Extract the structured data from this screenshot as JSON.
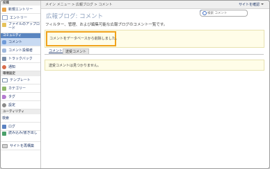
{
  "header": {
    "breadcrumb": "メイン メニュー > 広報ブログ > コメント",
    "site_link": "サイトを確認"
  },
  "search": {
    "placeholder": "検索 コメント"
  },
  "main": {
    "title": "広報ブログ: コメント",
    "description": "フィルター、管理、および編集可能な広報ブログのコメント一覧です。",
    "message": "コメントをデータベースから削除しました。",
    "tabs": [
      {
        "label": "コメント"
      },
      {
        "label": "送受コメント"
      }
    ],
    "empty_message": "送受コメントは見つかりません。"
  },
  "sidebar": {
    "sections": [
      {
        "title": "投稿",
        "items": [
          {
            "label": "新規エントリー",
            "icon": "pen-icon"
          },
          {
            "label": "エントリー",
            "icon": "document-icon"
          },
          {
            "label": "ファイルのアップロード",
            "icon": "folder-icon"
          }
        ]
      },
      {
        "title": "コミュニティ",
        "items": [
          {
            "label": "コメント",
            "icon": "comment-icon",
            "active": true
          },
          {
            "label": "コメント投稿者",
            "icon": "commenter-icon"
          },
          {
            "label": "トラックバック",
            "icon": "trackback-icon"
          },
          {
            "label": "通知",
            "icon": "notification-icon"
          }
        ]
      },
      {
        "title": "環境設定",
        "items": [
          {
            "label": "テンプレート",
            "icon": "template-icon"
          },
          {
            "label": "カテゴリー",
            "icon": "category-icon"
          },
          {
            "label": "タグ",
            "icon": "tag-icon"
          },
          {
            "label": "設定",
            "icon": "gear-icon"
          }
        ]
      },
      {
        "title": "ユーティリティ",
        "items": [
          {
            "label": "検索",
            "icon": "search-icon"
          },
          {
            "label": "ログ",
            "icon": "log-icon"
          },
          {
            "label": "読み込み/書き出し",
            "icon": "import-export-icon"
          },
          {
            "label": "サイトを再構築",
            "icon": "rebuild-icon"
          }
        ]
      }
    ]
  },
  "colors": {
    "sidebar_section_active": "#5a85c0",
    "highlight_border": "#f0a31c",
    "message_background": "#fffde8",
    "title_color": "#8fa2bf"
  }
}
